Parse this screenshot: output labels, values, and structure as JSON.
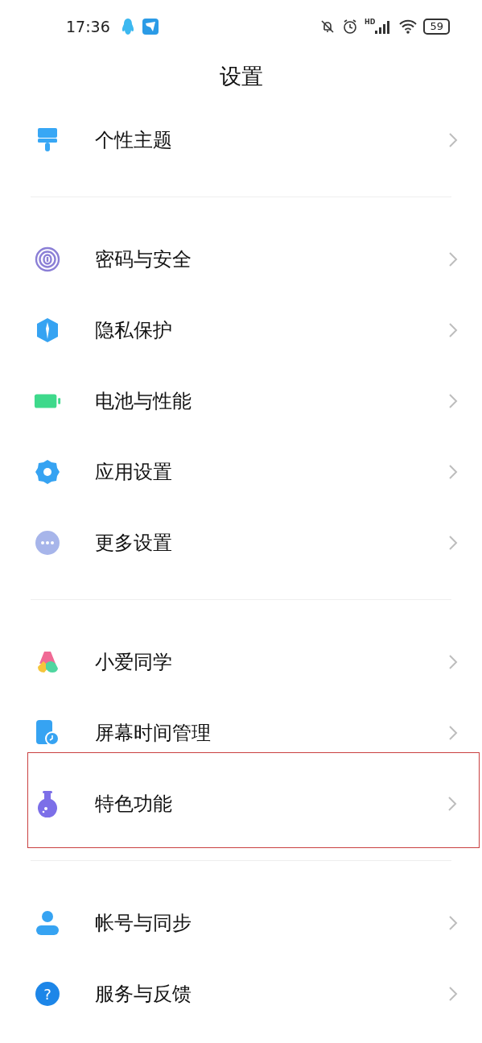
{
  "status_bar": {
    "time": "17:36",
    "network_label": "HD",
    "battery": "59"
  },
  "title": "设置",
  "groups": [
    {
      "items": [
        {
          "label": "个性主题",
          "kind": "brush",
          "highlighted": false
        }
      ]
    },
    {
      "items": [
        {
          "label": "密码与安全",
          "kind": "fingerprint",
          "highlighted": false
        },
        {
          "label": "隐私保护",
          "kind": "shield",
          "highlighted": false
        },
        {
          "label": "电池与性能",
          "kind": "battery",
          "highlighted": false
        },
        {
          "label": "应用设置",
          "kind": "gear",
          "highlighted": false
        },
        {
          "label": "更多设置",
          "kind": "dots",
          "highlighted": false
        }
      ]
    },
    {
      "items": [
        {
          "label": "小爱同学",
          "kind": "assistant",
          "highlighted": false
        },
        {
          "label": "屏幕时间管理",
          "kind": "screentime",
          "highlighted": false
        },
        {
          "label": "特色功能",
          "kind": "flask",
          "highlighted": true
        }
      ]
    },
    {
      "items": [
        {
          "label": "帐号与同步",
          "kind": "person",
          "highlighted": false
        },
        {
          "label": "服务与反馈",
          "kind": "help",
          "glyph": "?",
          "highlighted": false
        }
      ]
    }
  ]
}
